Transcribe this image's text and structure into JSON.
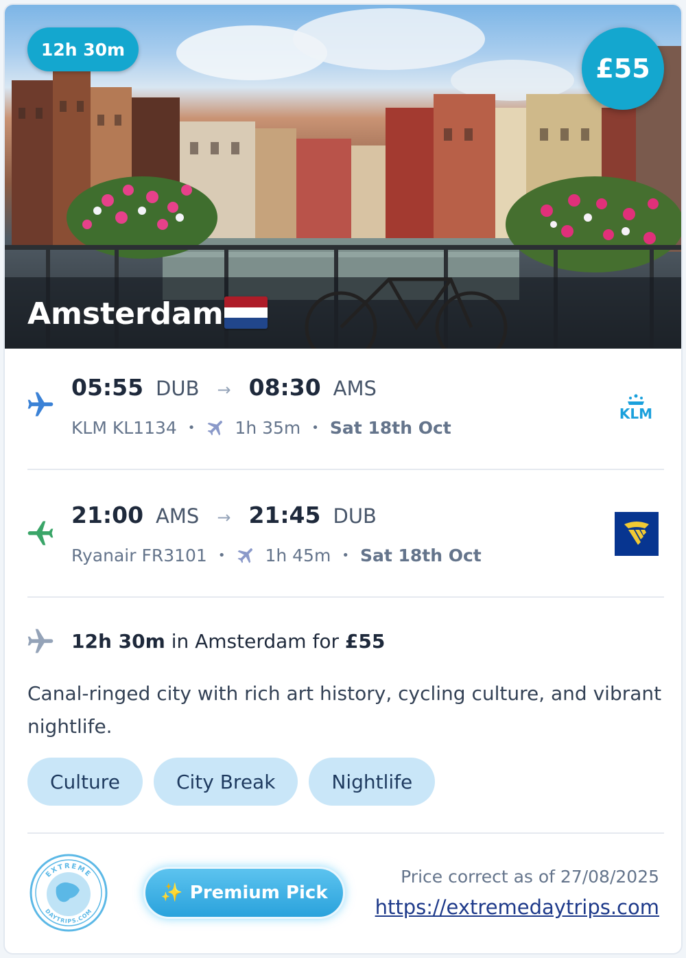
{
  "hero": {
    "duration_badge": "12h 30m",
    "price_badge": "£55",
    "city": "Amsterdam",
    "flag_colors": [
      "#ae1c28",
      "#ffffff",
      "#21468b"
    ]
  },
  "outbound": {
    "depart_time": "05:55",
    "depart_code": "DUB",
    "arrow": "→",
    "arrive_time": "08:30",
    "arrive_code": "AMS",
    "airline_flight": "KLM KL1134",
    "duration": "1h 35m",
    "date": "Sat 18th Oct",
    "airline_logo_text": "KLM",
    "icon": "plane-departure-icon",
    "icon_color": "#3b82d6"
  },
  "return": {
    "depart_time": "21:00",
    "depart_code": "AMS",
    "arrow": "→",
    "arrive_time": "21:45",
    "arrive_code": "DUB",
    "airline_flight": "Ryanair FR3101",
    "duration": "1h 45m",
    "date": "Sat 18th Oct",
    "icon": "plane-return-icon",
    "icon_color": "#3aa568"
  },
  "separator": "•",
  "summary": {
    "duration": "12h 30m",
    "mid_text": " in Amsterdam for ",
    "price": "£55",
    "description": "Canal-ringed city with rich art history, cycling culture, and vibrant nightlife."
  },
  "tags": [
    "Culture",
    "City Break",
    "Nightlife"
  ],
  "footer": {
    "logo_text_top": "EXTREME",
    "logo_text_bottom": "DAYTRIPS.COM",
    "premium_label": "Premium Pick",
    "premium_icon": "✨",
    "price_note": "Price correct as of 27/08/2025",
    "link": "https://extremedaytrips.com"
  },
  "colors": {
    "accent": "#14a7cf",
    "tag_bg": "#c9e6f8"
  }
}
